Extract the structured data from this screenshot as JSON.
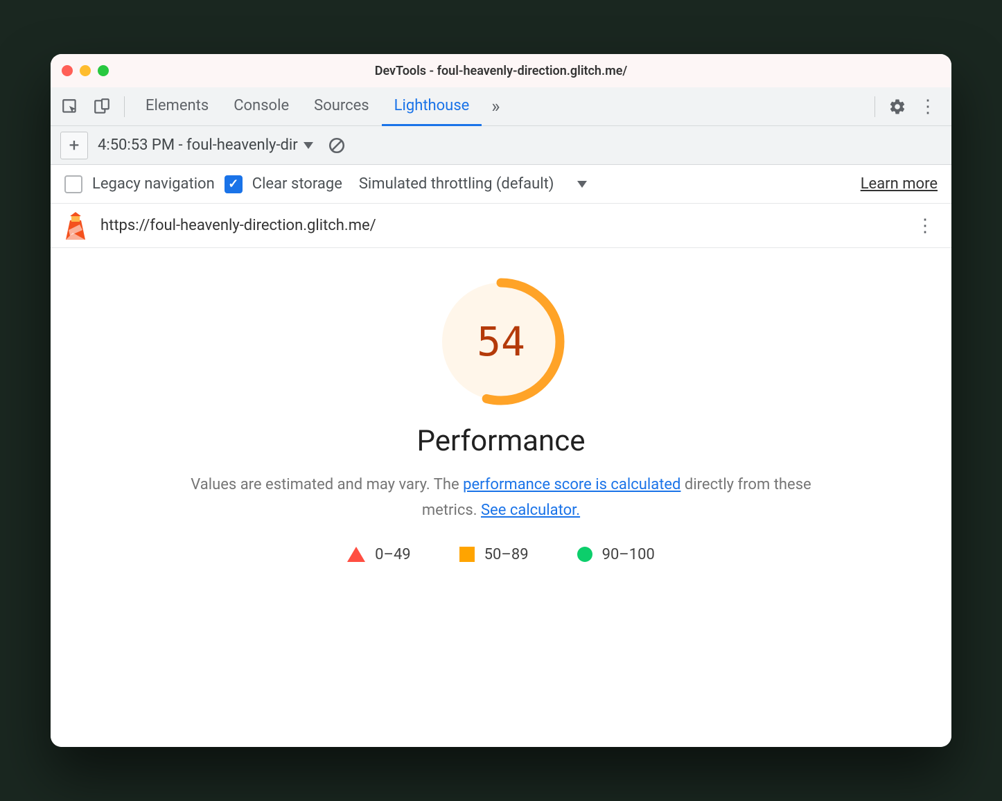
{
  "window": {
    "title": "DevTools - foul-heavenly-direction.glitch.me/"
  },
  "tabs": {
    "items": [
      "Elements",
      "Console",
      "Sources",
      "Lighthouse"
    ],
    "active": "Lighthouse"
  },
  "toolbar": {
    "report_label": "4:50:53 PM - foul-heavenly-dir"
  },
  "options": {
    "legacy_label": "Legacy navigation",
    "legacy_checked": false,
    "clear_label": "Clear storage",
    "clear_checked": true,
    "throttling_label": "Simulated throttling (default)",
    "learn_more": "Learn more"
  },
  "report": {
    "url": "https://foul-heavenly-direction.glitch.me/",
    "score": "54",
    "score_fraction": 0.54,
    "section_title": "Performance",
    "desc_prefix": "Values are estimated and may vary. The ",
    "desc_link1": "performance score is calculated",
    "desc_mid": " directly from these metrics. ",
    "desc_link2": "See calculator.",
    "legend": {
      "r1": "0–49",
      "r2": "50–89",
      "r3": "90–100"
    },
    "colors": {
      "gauge_arc": "#ffa327",
      "gauge_bg": "#fff6ea",
      "gauge_num": "#b43a0a"
    }
  }
}
